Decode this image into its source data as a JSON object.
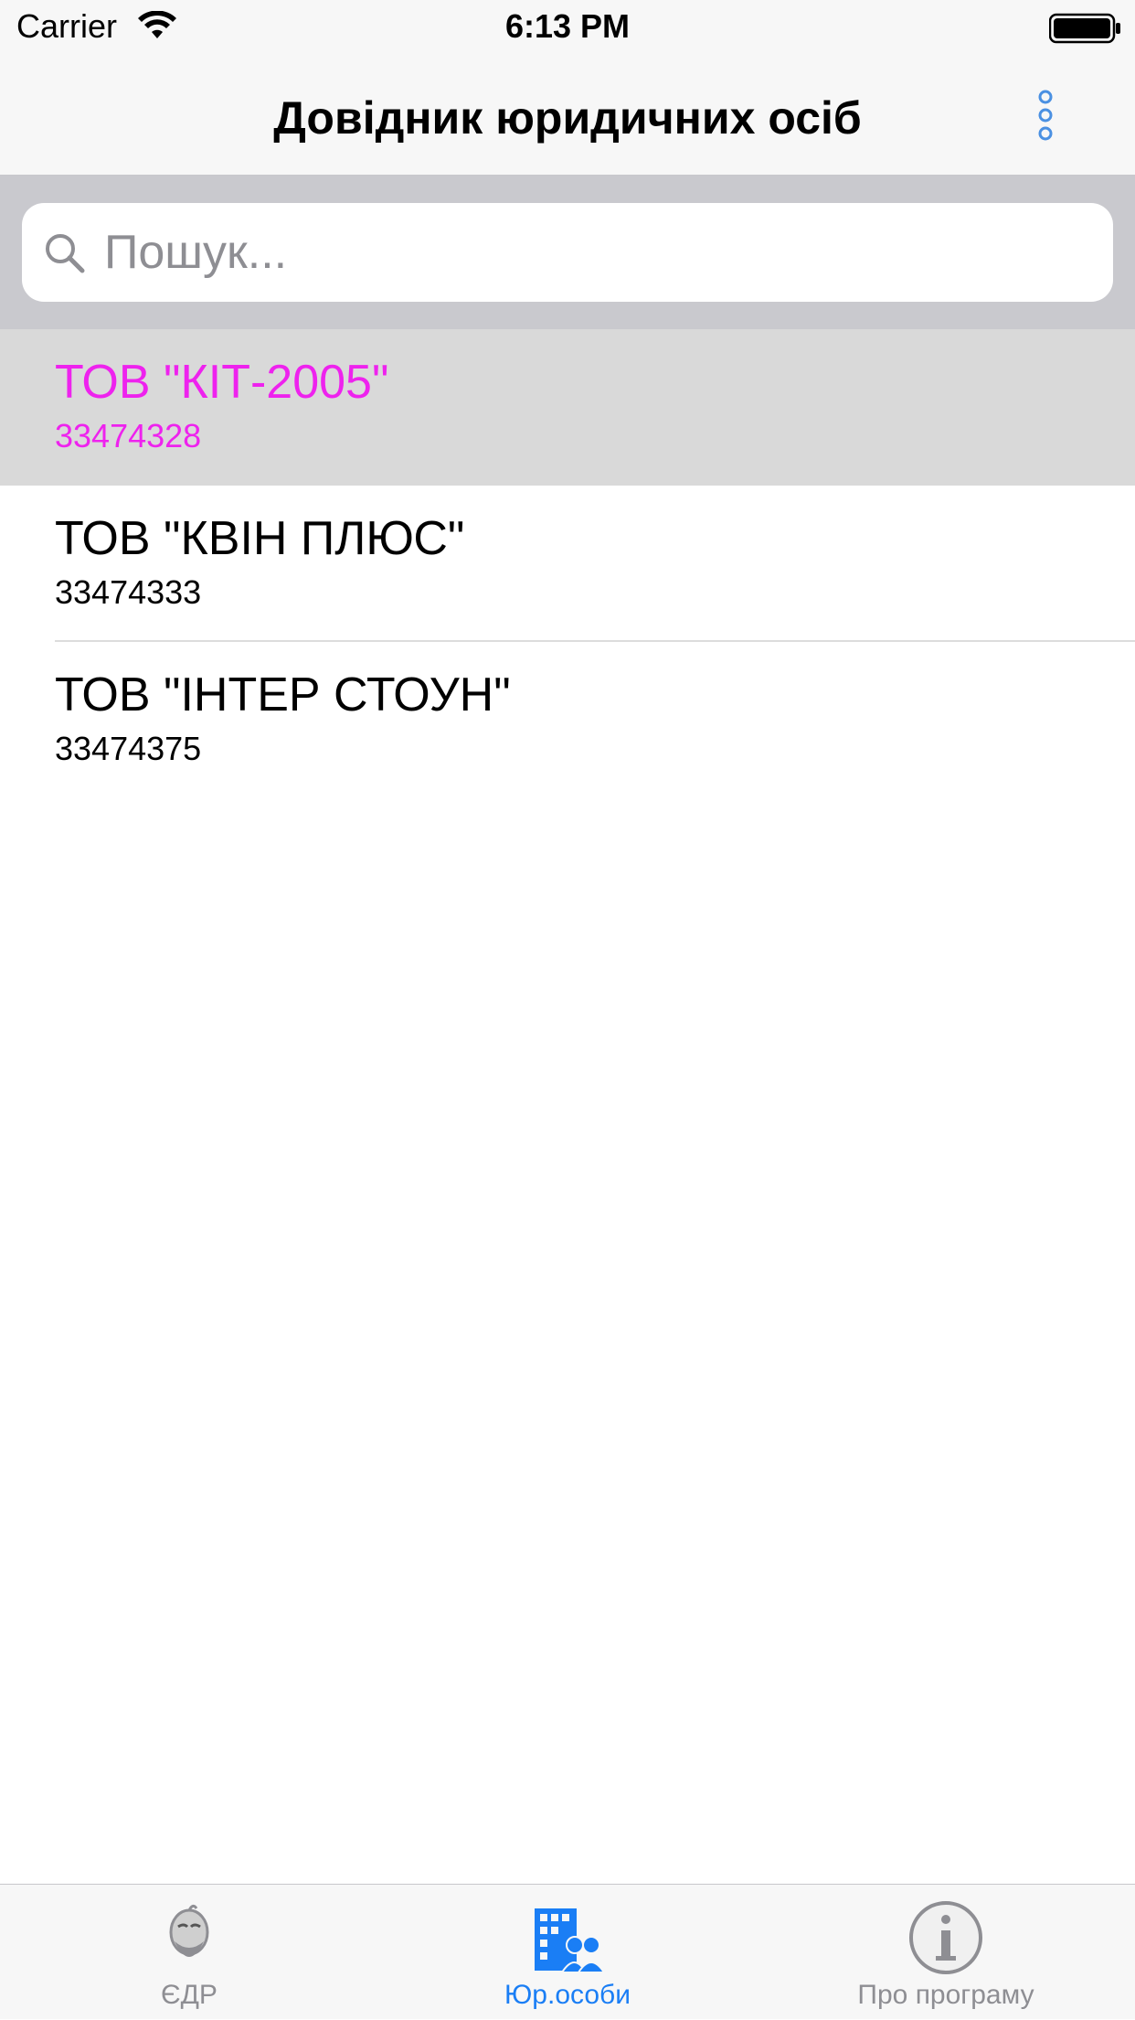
{
  "status_bar": {
    "carrier": "Carrier",
    "time": "6:13 PM"
  },
  "nav": {
    "title": "Довідник юридичних осіб",
    "more_icon": "more-vertical-icon"
  },
  "search": {
    "placeholder": "Пошук...",
    "value": ""
  },
  "list": {
    "items": [
      {
        "title": "ТОВ \"КІТ-2005\"",
        "code": "33474328",
        "selected": true
      },
      {
        "title": "ТОВ \"КВІН ПЛЮС\"",
        "code": "33474333",
        "selected": false
      },
      {
        "title": "ТОВ \"ІНТЕР СТОУН\"",
        "code": "33474375",
        "selected": false
      }
    ]
  },
  "tabs": [
    {
      "label": "ЄДР",
      "icon": "edr-icon",
      "active": false
    },
    {
      "label": "Юр.особи",
      "icon": "companies-icon",
      "active": true
    },
    {
      "label": "Про програму",
      "icon": "info-icon",
      "active": false
    }
  ],
  "colors": {
    "selected_text": "#ee22ee",
    "selected_row": "#d9d9d9",
    "tab_active": "#1a7ef5",
    "tab_inactive": "#8e8e93",
    "search_bar_bg": "#c9c9ce"
  }
}
